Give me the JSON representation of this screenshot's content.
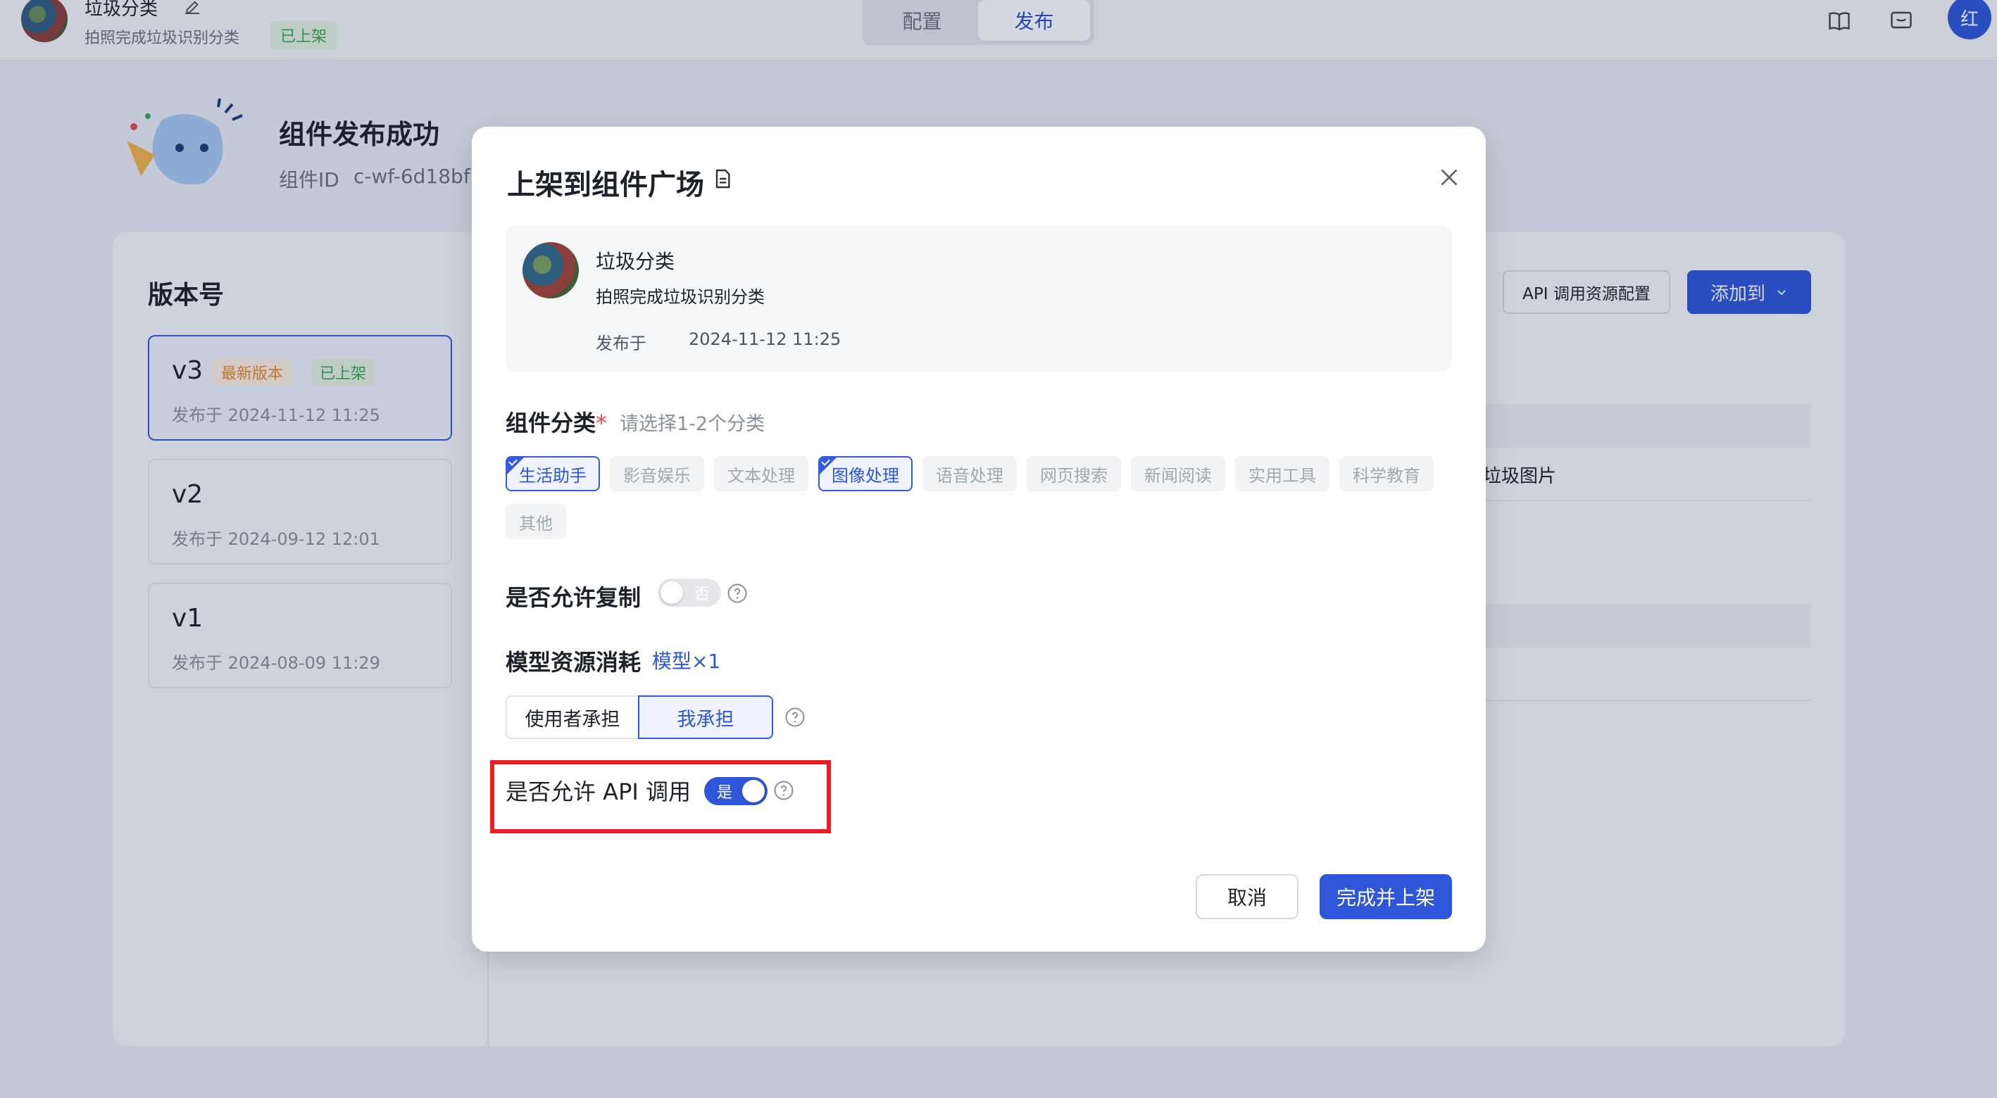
{
  "header": {
    "app_name": "垃圾分类",
    "app_desc": "拍照完成垃圾识别分类",
    "status_badge": "已上架",
    "tabs": [
      "配置",
      "发布"
    ],
    "active_tab": "发布",
    "user_initial": "红",
    "icons": [
      "edit-icon",
      "book-icon",
      "feedback-icon"
    ]
  },
  "publish_page": {
    "success_title": "组件发布成功",
    "component_id_label": "组件ID",
    "component_id_value": "c-wf-6d18bf",
    "versions_title": "版本号",
    "versions": [
      {
        "label": "v3",
        "tags": [
          "最新版本",
          "已上架"
        ],
        "date": "发布于 2024-11-12 11:25",
        "selected": true
      },
      {
        "label": "v2",
        "tags": [],
        "date": "发布于 2024-09-12 12:01",
        "selected": false
      },
      {
        "label": "v1",
        "tags": [],
        "date": "发布于 2024-08-09 11:29",
        "selected": false
      }
    ],
    "api_config_button": "API 调用资源配置",
    "add_to_button": "添加到",
    "partial_text": "垃圾图片"
  },
  "modal": {
    "title": "上架到组件广场",
    "component": {
      "name": "垃圾分类",
      "desc": "拍照完成垃圾识别分类",
      "date_label": "发布于",
      "date_value": "2024-11-12 11:25"
    },
    "category": {
      "label": "组件分类",
      "required_mark": "*",
      "hint": "请选择1-2个分类",
      "options": [
        {
          "label": "生活助手",
          "selected": true
        },
        {
          "label": "影音娱乐",
          "selected": false
        },
        {
          "label": "文本处理",
          "selected": false
        },
        {
          "label": "图像处理",
          "selected": true
        },
        {
          "label": "语音处理",
          "selected": false
        },
        {
          "label": "网页搜索",
          "selected": false
        },
        {
          "label": "新闻阅读",
          "selected": false
        },
        {
          "label": "实用工具",
          "selected": false
        },
        {
          "label": "科学教育",
          "selected": false
        },
        {
          "label": "其他",
          "selected": false
        }
      ]
    },
    "allow_copy": {
      "label": "是否允许复制",
      "on": false,
      "toggle_text": "否"
    },
    "model_cost": {
      "label": "模型资源消耗",
      "link": "模型×1",
      "options": [
        "使用者承担",
        "我承担"
      ],
      "selected": "我承担"
    },
    "allow_api": {
      "label": "是否允许 API 调用",
      "on": true,
      "toggle_text": "是"
    },
    "cancel_button": "取消",
    "submit_button": "完成并上架",
    "colors": {
      "primary": "#2f56d8",
      "highlight": "#ee1c25",
      "success": "#3fa34d",
      "warning": "#e58a2c"
    }
  }
}
